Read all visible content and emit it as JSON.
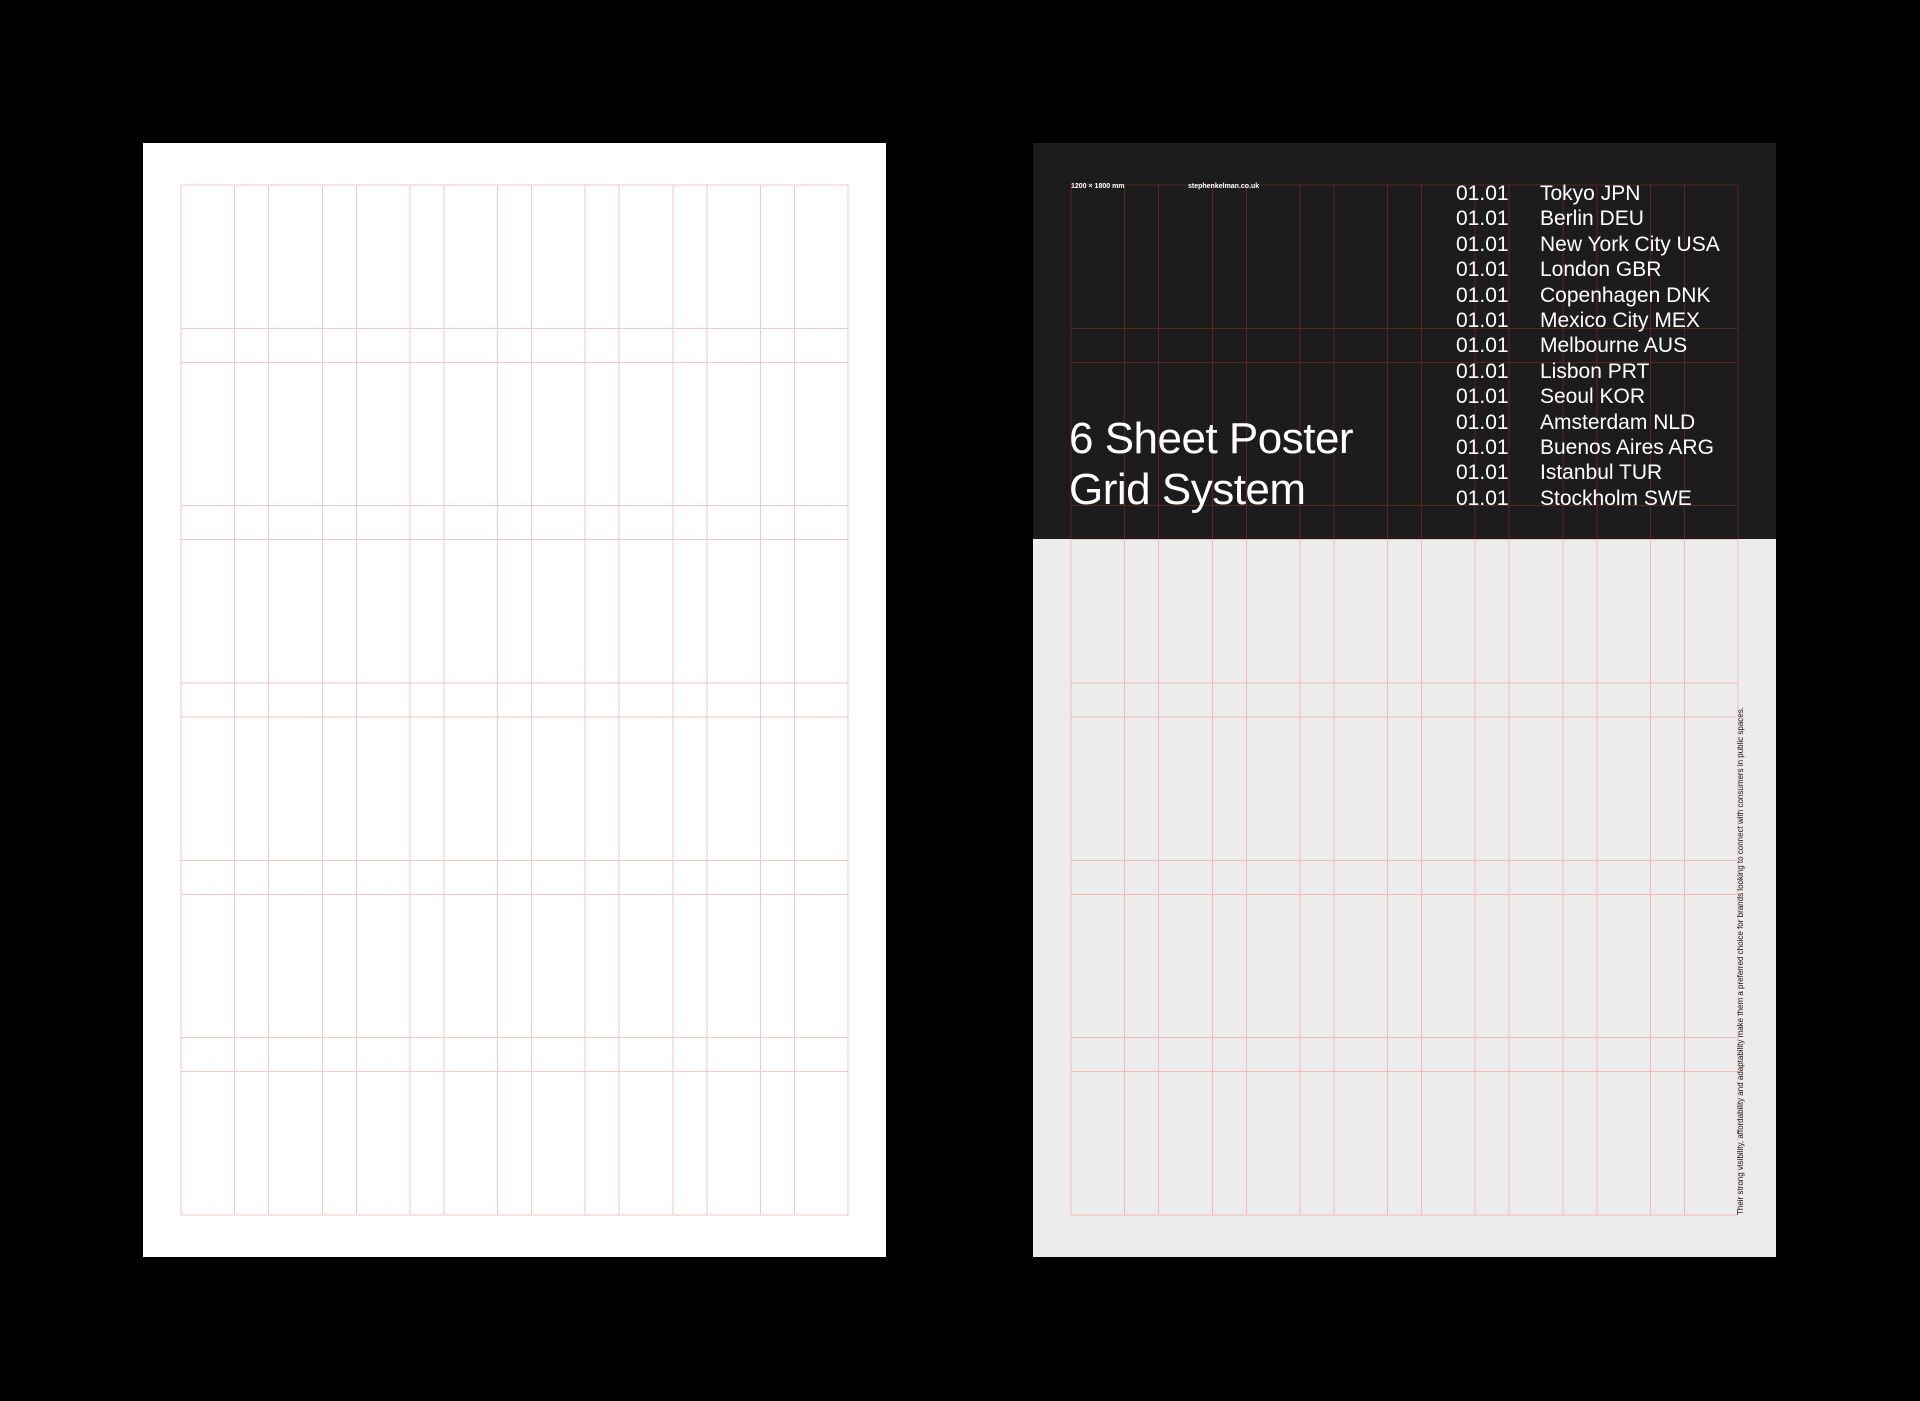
{
  "left_sheet": {
    "background": "#ffffff",
    "guide_color": "#f5c7c5"
  },
  "right_sheet": {
    "top_band_color": "#1c1c1c",
    "lower_background": "#ececec",
    "size_label": "1200 × 1800 mm",
    "website": "stephenkelman.co.uk",
    "title_lines": [
      "6 Sheet Poster",
      "Grid System"
    ],
    "cities": [
      {
        "code": "01.01",
        "name": "Tokyo JPN"
      },
      {
        "code": "01.01",
        "name": "Berlin DEU"
      },
      {
        "code": "01.01",
        "name": "New York City USA"
      },
      {
        "code": "01.01",
        "name": "London GBR"
      },
      {
        "code": "01.01",
        "name": "Copenhagen DNK"
      },
      {
        "code": "01.01",
        "name": "Mexico City MEX"
      },
      {
        "code": "01.01",
        "name": "Melbourne AUS"
      },
      {
        "code": "01.01",
        "name": "Lisbon PRT"
      },
      {
        "code": "01.01",
        "name": "Seoul KOR"
      },
      {
        "code": "01.01",
        "name": "Amsterdam NLD"
      },
      {
        "code": "01.01",
        "name": "Buenos Aires ARG"
      },
      {
        "code": "01.01",
        "name": "Istanbul TUR"
      },
      {
        "code": "01.01",
        "name": "Stockholm SWE"
      }
    ],
    "vertical_note": "Their strong visibility, affordability and adaptability make them a preferred choice for brands looking to connect with consumers in public spaces."
  }
}
